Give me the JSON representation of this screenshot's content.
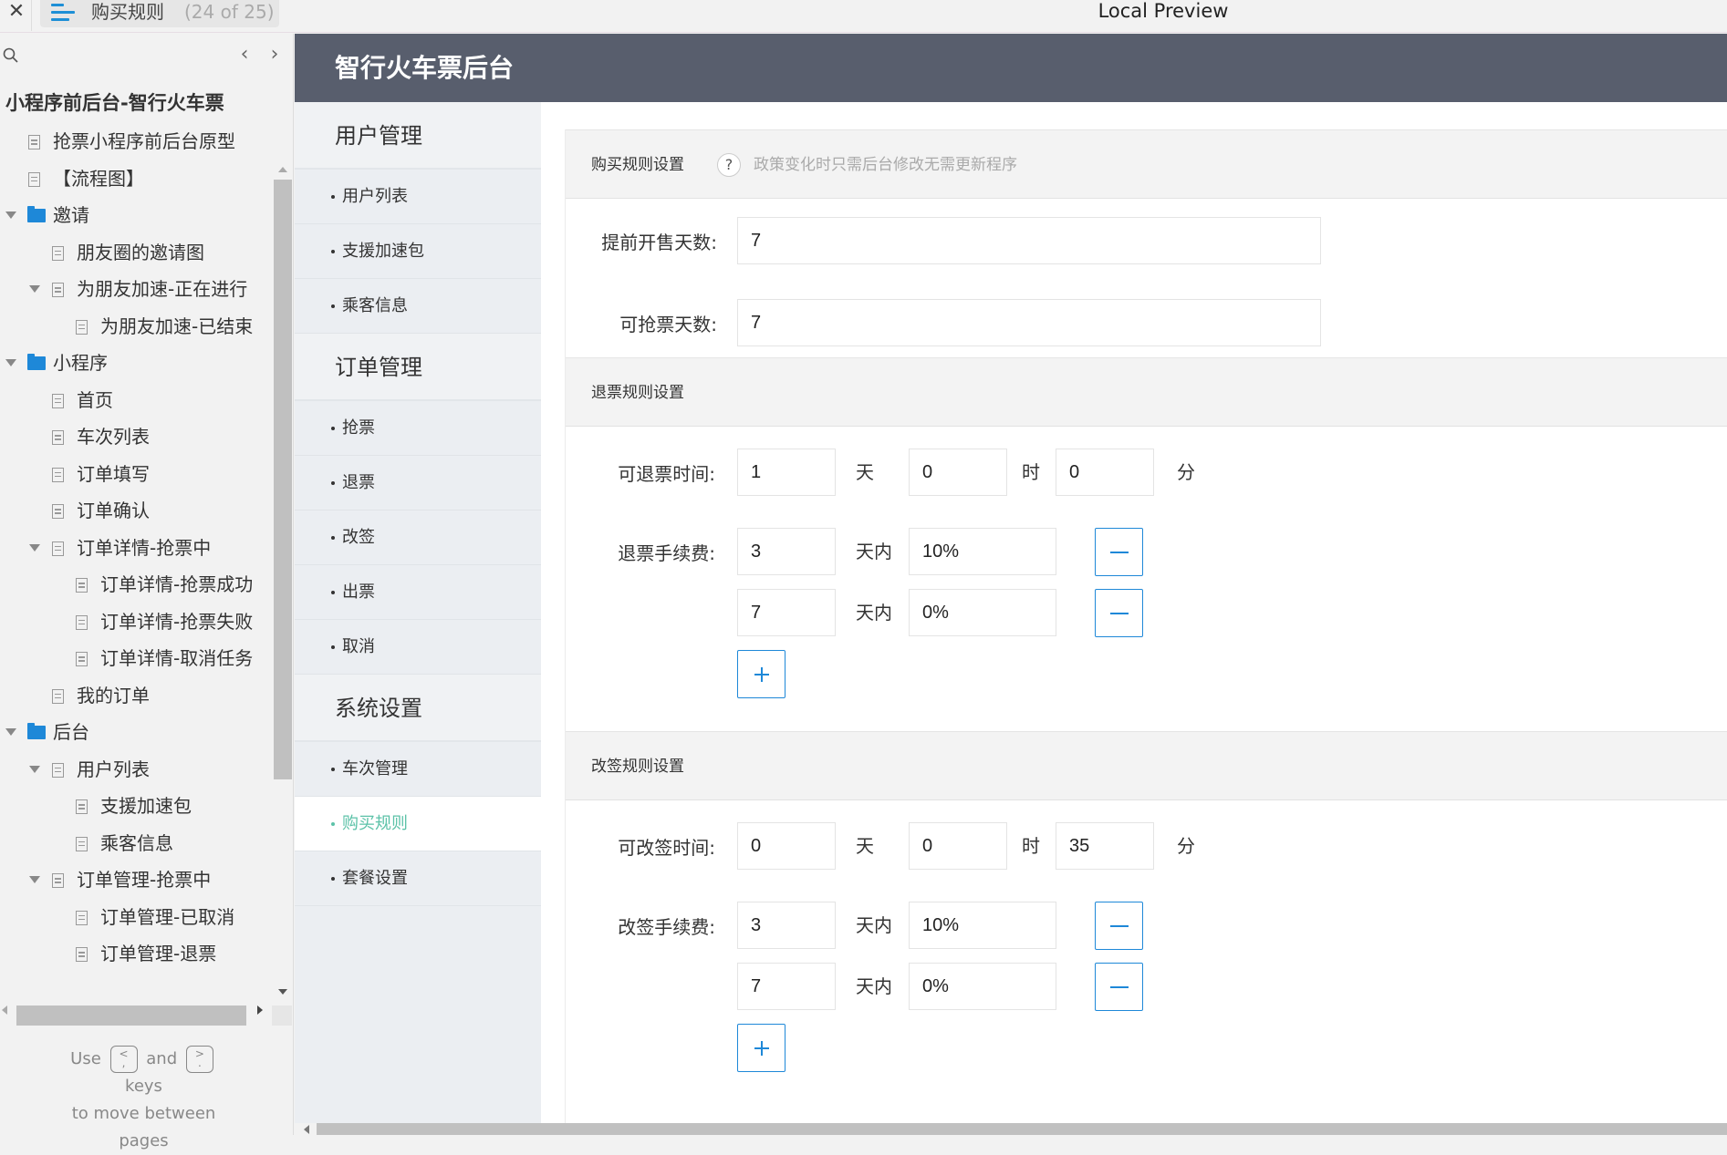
{
  "titlebar": {
    "close_icon": "close-icon",
    "page_title": "购买规则",
    "page_count": "(24 of 25)",
    "preview_title": "Local Preview"
  },
  "sidebar": {
    "prev_label": "‹",
    "next_label": "›",
    "project_title": "小程序前后台-智行火车票",
    "tree": [
      {
        "label": "抢票小程序前后台原型",
        "type": "page",
        "level": 1,
        "expanded": null
      },
      {
        "label": "【流程图】",
        "type": "page",
        "level": 1,
        "expanded": null
      },
      {
        "label": "邀请",
        "type": "folder",
        "level": 0,
        "expanded": true
      },
      {
        "label": "朋友圈的邀请图",
        "type": "page",
        "level": 2,
        "expanded": null
      },
      {
        "label": "为朋友加速-正在进行",
        "type": "page",
        "level": 2,
        "expanded": true
      },
      {
        "label": "为朋友加速-已结束",
        "type": "page",
        "level": 3,
        "expanded": null
      },
      {
        "label": "小程序",
        "type": "folder",
        "level": 0,
        "expanded": true
      },
      {
        "label": "首页",
        "type": "page",
        "level": 2,
        "expanded": null
      },
      {
        "label": "车次列表",
        "type": "page",
        "level": 2,
        "expanded": null
      },
      {
        "label": "订单填写",
        "type": "page",
        "level": 2,
        "expanded": null
      },
      {
        "label": "订单确认",
        "type": "page",
        "level": 2,
        "expanded": null
      },
      {
        "label": "订单详情-抢票中",
        "type": "page",
        "level": 2,
        "expanded": true
      },
      {
        "label": "订单详情-抢票成功",
        "type": "page",
        "level": 3,
        "expanded": null
      },
      {
        "label": "订单详情-抢票失败",
        "type": "page",
        "level": 3,
        "expanded": null
      },
      {
        "label": "订单详情-取消任务",
        "type": "page",
        "level": 3,
        "expanded": null
      },
      {
        "label": "我的订单",
        "type": "page",
        "level": 2,
        "expanded": null
      },
      {
        "label": "后台",
        "type": "folder",
        "level": 0,
        "expanded": true
      },
      {
        "label": "用户列表",
        "type": "page",
        "level": 2,
        "expanded": true
      },
      {
        "label": "支援加速包",
        "type": "page",
        "level": 3,
        "expanded": null
      },
      {
        "label": "乘客信息",
        "type": "page",
        "level": 3,
        "expanded": null
      },
      {
        "label": "订单管理-抢票中",
        "type": "page",
        "level": 2,
        "expanded": true
      },
      {
        "label": "订单管理-已取消",
        "type": "page",
        "level": 3,
        "expanded": null
      },
      {
        "label": "订单管理-退票",
        "type": "page",
        "level": 3,
        "expanded": null
      }
    ],
    "hint": {
      "use": "Use",
      "key_prev": "<\n,",
      "and": "and",
      "key_next": ">\n.",
      "keys": "keys",
      "line2": "to move between",
      "line3": "pages"
    }
  },
  "app": {
    "brand": "智行火车票后台",
    "nav": [
      {
        "kind": "group",
        "label": "用户管理"
      },
      {
        "kind": "item",
        "label": "用户列表",
        "active": false
      },
      {
        "kind": "item",
        "label": "支援加速包",
        "active": false
      },
      {
        "kind": "item",
        "label": "乘客信息",
        "active": false
      },
      {
        "kind": "group",
        "label": "订单管理"
      },
      {
        "kind": "item",
        "label": "抢票",
        "active": false
      },
      {
        "kind": "item",
        "label": "退票",
        "active": false
      },
      {
        "kind": "item",
        "label": "改签",
        "active": false
      },
      {
        "kind": "item",
        "label": "出票",
        "active": false
      },
      {
        "kind": "item",
        "label": "取消",
        "active": false
      },
      {
        "kind": "group",
        "label": "系统设置"
      },
      {
        "kind": "item",
        "label": "车次管理",
        "active": false
      },
      {
        "kind": "item",
        "label": "购买规则",
        "active": true
      },
      {
        "kind": "item",
        "label": "套餐设置",
        "active": false
      }
    ],
    "purchase": {
      "title": "购买规则设置",
      "help_icon": "?",
      "help_text": "政策变化时只需后台修改无需更新程序",
      "presale_label": "提前开售天数:",
      "presale_value": "7",
      "grab_label": "可抢票天数:",
      "grab_value": "7"
    },
    "refund": {
      "title": "退票规则设置",
      "time_label": "可退票时间:",
      "days": "1",
      "day_unit": "天",
      "hours": "0",
      "hour_unit": "时",
      "minutes": "0",
      "minute_unit": "分",
      "fee_label": "退票手续费:",
      "within_unit": "天内",
      "fees": [
        {
          "days": "3",
          "percent": "10%"
        },
        {
          "days": "7",
          "percent": "0%"
        }
      ]
    },
    "change": {
      "title": "改签规则设置",
      "time_label": "可改签时间:",
      "days": "0",
      "day_unit": "天",
      "hours": "0",
      "hour_unit": "时",
      "minutes": "35",
      "minute_unit": "分",
      "fee_label": "改签手续费:",
      "within_unit": "天内",
      "fees": [
        {
          "days": "3",
          "percent": "10%"
        },
        {
          "days": "7",
          "percent": "0%"
        }
      ]
    },
    "colors": {
      "header_bg": "#585e6d",
      "accent_blue": "#1e88d8",
      "active_green": "#5cc2a8"
    }
  }
}
